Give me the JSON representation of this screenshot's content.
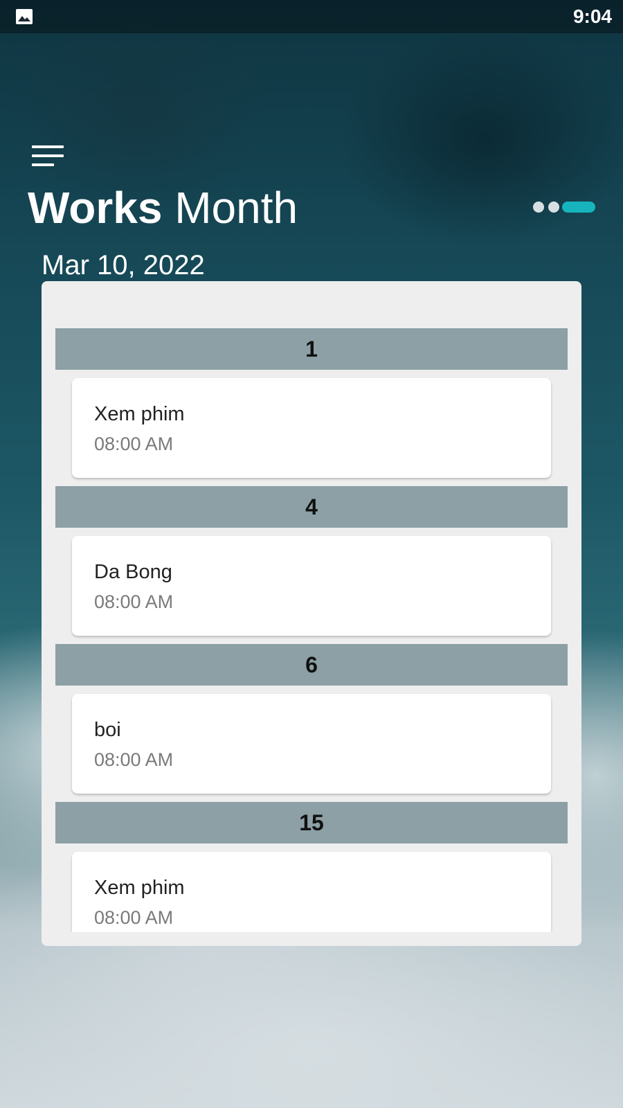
{
  "status_bar": {
    "time": "9:04",
    "notification_icon": "image-icon"
  },
  "header": {
    "menu_icon": "menu-icon",
    "title_bold": "Works",
    "title_light": "Month",
    "page_indicator": {
      "count": 3,
      "active_index": 2
    },
    "date": "Mar 10, 2022"
  },
  "colors": {
    "accent": "#17b4bd",
    "day_header_bg": "#8ca0a5",
    "panel_bg": "#eeeeee"
  },
  "days": [
    {
      "day": "1",
      "tasks": [
        {
          "title": "Xem phim",
          "time": "08:00 AM"
        }
      ]
    },
    {
      "day": "4",
      "tasks": [
        {
          "title": "Da Bong",
          "time": "08:00 AM"
        }
      ]
    },
    {
      "day": "6",
      "tasks": [
        {
          "title": "boi",
          "time": "08:00 AM"
        }
      ]
    },
    {
      "day": "15",
      "tasks": [
        {
          "title": "Xem phim",
          "time": "08:00 AM"
        }
      ]
    }
  ]
}
